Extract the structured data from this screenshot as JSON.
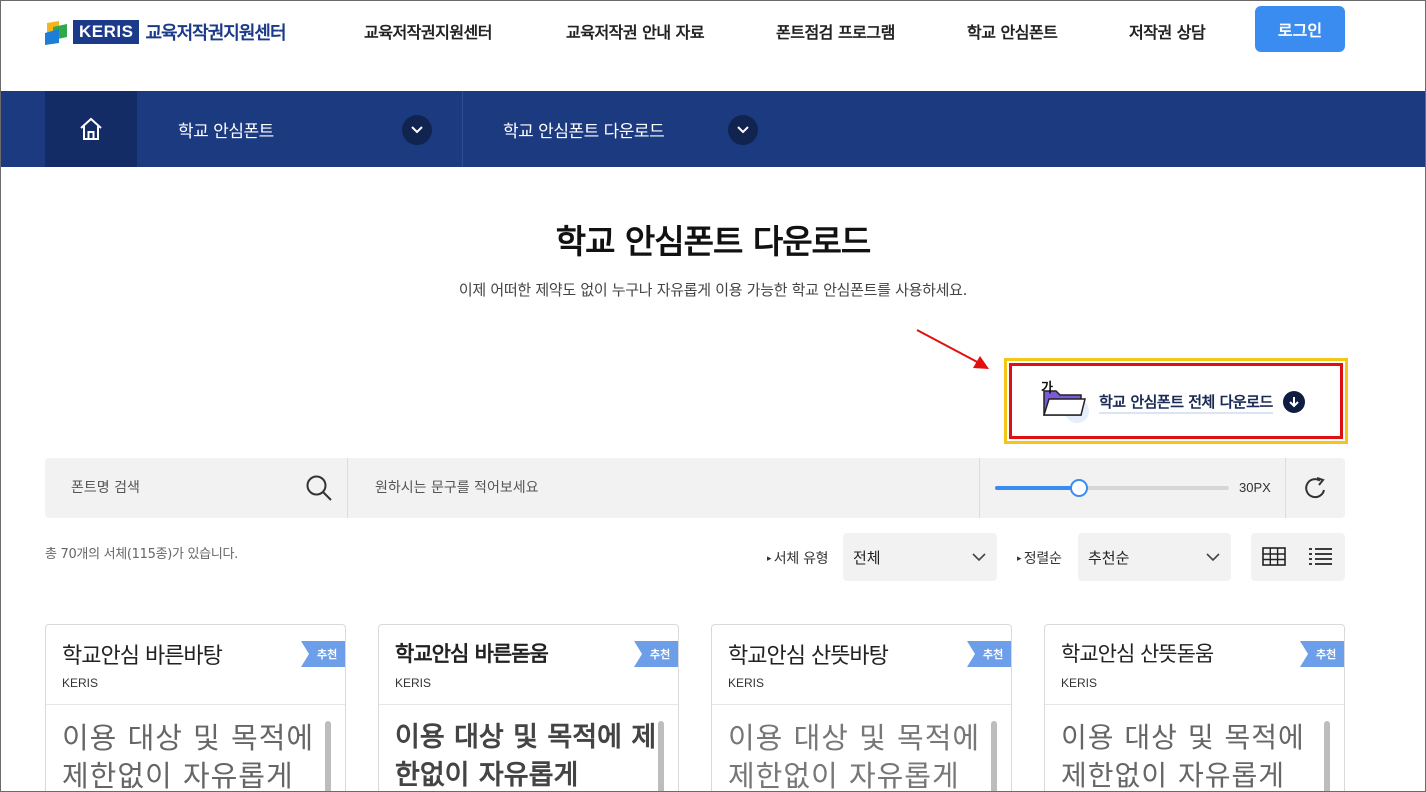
{
  "header": {
    "logo_mark": "KERIS",
    "logo_text": "교육저작권지원센터",
    "nav": [
      "교육저작권지원센터",
      "교육저작권 안내 자료",
      "폰트점검 프로그램",
      "학교 안심폰트",
      "저작권 상담"
    ],
    "login_label": "로그인"
  },
  "location": {
    "depth1": "학교 안심폰트",
    "depth2": "학교 안심폰트 다운로드"
  },
  "page": {
    "title": "학교 안심폰트 다운로드",
    "subtitle": "이제 어떠한 제약도 없이 누구나 자유롭게 이용 가능한 학교 안심폰트를 사용하세요."
  },
  "download_all": {
    "icon_glyph": "가",
    "label": "학교 안심폰트 전체 다운로드"
  },
  "search": {
    "font_placeholder": "폰트명 검색",
    "phrase_placeholder": "원하시는 문구를 적어보세요",
    "size_value": 30,
    "size_label": "30PX",
    "size_fraction": 0.36
  },
  "filters": {
    "count_text": "총 70개의 서체(115종)가 있습니다.",
    "type_label": "서체 유형",
    "type_value": "전체",
    "sort_label": "정렬순",
    "sort_value": "추천순"
  },
  "colors": {
    "brand": "#1c3a80",
    "accent": "#3b8cf0",
    "badge": "#6d9eea"
  },
  "cards": [
    {
      "name": "학교안심 바른바탕",
      "maker": "KERIS",
      "badge": "추천",
      "preview": "이용 대상 및 목적에 제한없이 자유롭게"
    },
    {
      "name": "학교안심 바른돋움",
      "maker": "KERIS",
      "badge": "추천",
      "preview": "이용 대상 및 목적에 제한없이 자유롭게"
    },
    {
      "name": "학교안심 산뜻바탕",
      "maker": "KERIS",
      "badge": "추천",
      "preview": "이용 대상 및 목적에 제한없이 자유롭게"
    },
    {
      "name": "학교안심 산뜻돋움",
      "maker": "KERIS",
      "badge": "추천",
      "preview": "이용 대상 및 목적에 제한없이 자유롭게"
    }
  ]
}
